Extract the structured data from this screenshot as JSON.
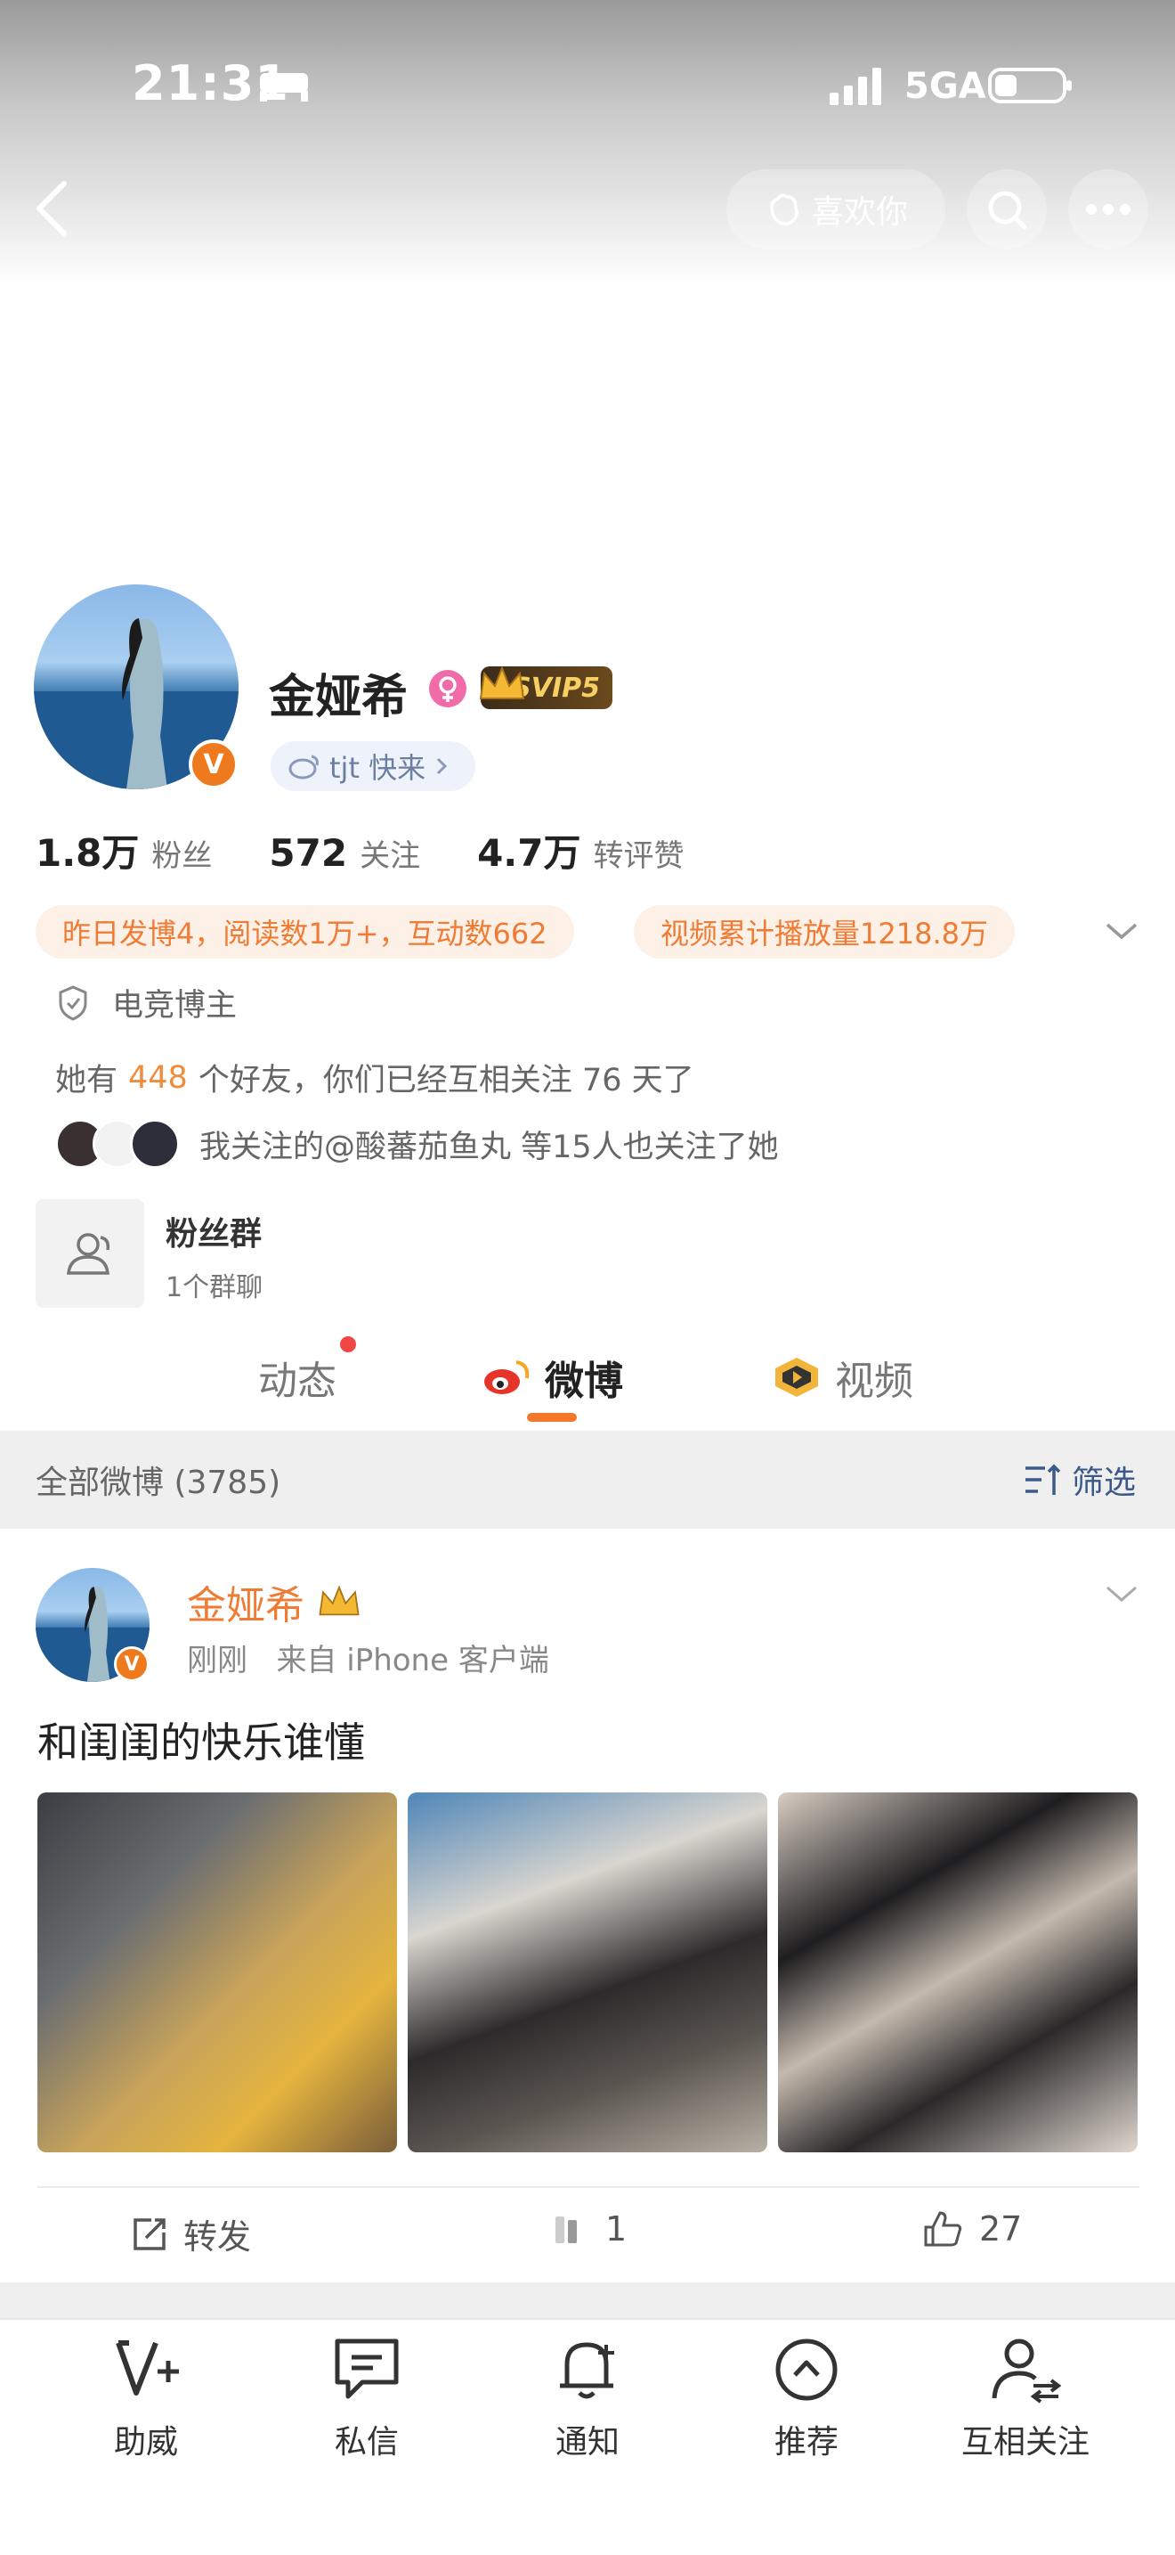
{
  "status": {
    "time": "21:31",
    "network": "5GA"
  },
  "header": {
    "like_label": "喜欢你"
  },
  "profile": {
    "name": "金娅希",
    "vip_badge": "SVIP5",
    "tag": "tjt 快来",
    "stats": [
      {
        "value": "1.8万",
        "label": "粉丝"
      },
      {
        "value": "572",
        "label": "关注"
      },
      {
        "value": "4.7万",
        "label": "转评赞"
      }
    ],
    "highlight_left": "昨日发博4，阅读数1万+，互动数662",
    "highlight_right": "视频累计播放量1218.8万",
    "category": "电竞博主",
    "friends_prefix": "她有",
    "friends_count": "448",
    "friends_suffix": "个好友，你们已经互相关注 76 天了",
    "mutual_follow": "我关注的@酸蕃茄鱼丸  等15人也关注了她",
    "fan_group_title": "粉丝群",
    "fan_group_sub": "1个群聊"
  },
  "tabs": [
    {
      "label": "动态"
    },
    {
      "label": "微博"
    },
    {
      "label": "视频"
    }
  ],
  "filter": {
    "count_label": "全部微博 (3785)",
    "filter_label": "筛选"
  },
  "post": {
    "author": "金娅希",
    "time": "刚刚",
    "source": "来自 iPhone 客户端",
    "text": "和闺闺的快乐谁懂",
    "repost_label": "转发",
    "comment_count": "1",
    "like_count": "27"
  },
  "bottom_bar": [
    {
      "label": "助威"
    },
    {
      "label": "私信"
    },
    {
      "label": "通知"
    },
    {
      "label": "推荐"
    },
    {
      "label": "互相关注"
    }
  ],
  "colors": {
    "accent_orange": "#f07b34",
    "verified_orange": "#ef7a1d",
    "link_blue": "#3b5a8a"
  }
}
